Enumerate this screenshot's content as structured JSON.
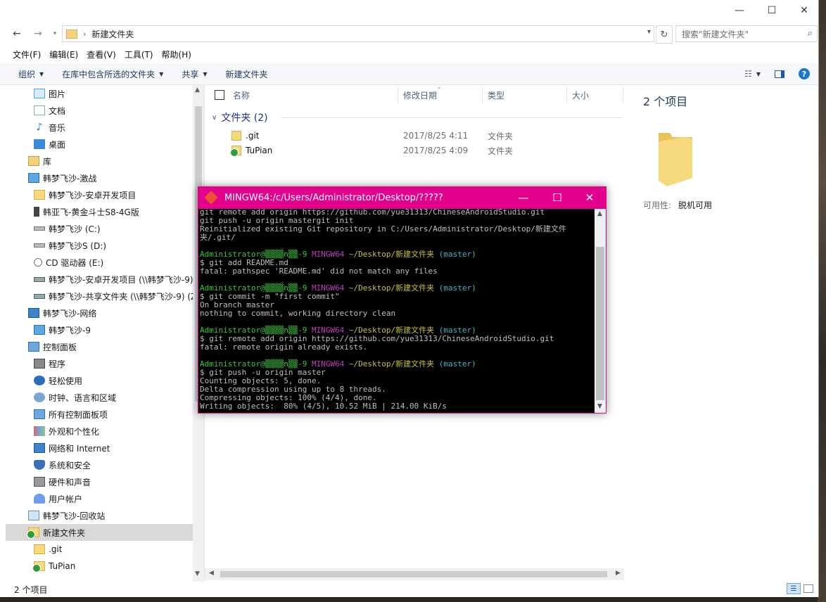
{
  "explorer": {
    "window_controls": {
      "minimize": "—",
      "maximize": "☐",
      "close": "✕"
    },
    "address": {
      "current": "新建文件夹"
    },
    "search": {
      "placeholder": "搜索\"新建文件夹\""
    },
    "menu": [
      "文件(F)",
      "编辑(E)",
      "查看(V)",
      "工具(T)",
      "帮助(H)"
    ],
    "toolbar": {
      "organize": "组织",
      "include_in_library": "在库中包含所选的文件夹",
      "share": "共享",
      "new_folder": "新建文件夹"
    },
    "nav": [
      {
        "label": "图片",
        "icon": "pictures-icon",
        "indent": 1
      },
      {
        "label": "文档",
        "icon": "documents-icon",
        "indent": 1
      },
      {
        "label": "音乐",
        "icon": "music-icon",
        "indent": 1
      },
      {
        "label": "桌面",
        "icon": "desktop-icon",
        "indent": 1
      },
      {
        "label": "库",
        "icon": "library-icon",
        "indent": 0
      },
      {
        "label": "韩梦飞沙-激战",
        "icon": "computer-icon",
        "indent": 0
      },
      {
        "label": "韩梦飞沙-安卓开发项目",
        "icon": "folder-icon",
        "indent": 1
      },
      {
        "label": "韩亚飞-黄金斗士S8-4G版",
        "icon": "phone-icon",
        "indent": 1
      },
      {
        "label": "韩梦飞沙 (C:)",
        "icon": "drive-icon",
        "indent": 1
      },
      {
        "label": "韩梦飞沙S (D:)",
        "icon": "drive-icon",
        "indent": 1
      },
      {
        "label": "CD 驱动器 (E:)",
        "icon": "cd-drive-icon",
        "indent": 1
      },
      {
        "label": "韩梦飞沙-安卓开发项目 (\\\\韩梦飞沙-9) (",
        "icon": "network-drive-icon",
        "indent": 1
      },
      {
        "label": "韩梦飞沙-共享文件夹 (\\\\韩梦飞沙-9) (Z",
        "icon": "network-drive-icon",
        "indent": 1
      },
      {
        "label": "韩梦飞沙-网络",
        "icon": "network-icon",
        "indent": 0
      },
      {
        "label": "韩梦飞沙-9",
        "icon": "computer-icon",
        "indent": 1
      },
      {
        "label": "控制面板",
        "icon": "control-panel-icon",
        "indent": 0
      },
      {
        "label": "程序",
        "icon": "programs-icon",
        "indent": 1
      },
      {
        "label": "轻松使用",
        "icon": "ease-of-access-icon",
        "indent": 1
      },
      {
        "label": "时钟、语言和区域",
        "icon": "clock-icon",
        "indent": 1
      },
      {
        "label": "所有控制面板项",
        "icon": "control-panel-icon",
        "indent": 1
      },
      {
        "label": "外观和个性化",
        "icon": "appearance-icon",
        "indent": 1
      },
      {
        "label": "网络和 Internet",
        "icon": "network-icon",
        "indent": 1
      },
      {
        "label": "系统和安全",
        "icon": "shield-icon",
        "indent": 1
      },
      {
        "label": "硬件和声音",
        "icon": "hardware-icon",
        "indent": 1
      },
      {
        "label": "用户帐户",
        "icon": "user-icon",
        "indent": 1
      },
      {
        "label": "韩梦飞沙-回收站",
        "icon": "recycle-bin-icon",
        "indent": 0
      },
      {
        "label": "新建文件夹",
        "icon": "folder-synced-icon",
        "indent": 0,
        "selected": true
      },
      {
        "label": ".git",
        "icon": "folder-icon",
        "indent": 1
      },
      {
        "label": "TuPian",
        "icon": "folder-synced-icon",
        "indent": 1
      }
    ],
    "columns": {
      "name": "名称",
      "modified": "修改日期",
      "type": "类型",
      "size": "大小"
    },
    "group": {
      "label": "文件夹 (2)"
    },
    "files": [
      {
        "name": ".git",
        "modified": "2017/8/25 4:11",
        "type": "文件夹",
        "icon": "folder-icon"
      },
      {
        "name": "TuPian",
        "modified": "2017/8/25 4:09",
        "type": "文件夹",
        "icon": "folder-synced-icon"
      }
    ],
    "details": {
      "title": "2 个项目",
      "availability_label": "可用性:",
      "availability_value": "脱机可用"
    },
    "status": {
      "count": "2 个项目"
    }
  },
  "terminal": {
    "title": "MINGW64:/c/Users/Administrator/Desktop/?????",
    "lines": [
      {
        "segments": [
          {
            "t": "git remote add origin https://github.com/yue31313/ChineseAndroidStudio.git",
            "c": ""
          }
        ]
      },
      {
        "segments": [
          {
            "t": "git push -u origin mastergit init",
            "c": ""
          }
        ]
      },
      {
        "segments": [
          {
            "t": "Reinitialized existing Git repository in C:/Users/Administrator/Desktop/新建文件",
            "c": ""
          }
        ]
      },
      {
        "segments": [
          {
            "t": "夹/.git/",
            "c": ""
          }
        ]
      },
      {
        "segments": [
          {
            "t": "",
            "c": ""
          }
        ]
      },
      {
        "segments": [
          {
            "t": "Administrator@▒▒▒▒n▒▒-9 ",
            "c": "c-green"
          },
          {
            "t": "MINGW64 ",
            "c": "c-mag"
          },
          {
            "t": "~/Desktop/新建文件夹 ",
            "c": "c-yel"
          },
          {
            "t": "(master)",
            "c": "c-cyan"
          }
        ]
      },
      {
        "segments": [
          {
            "t": "$ git add README.md",
            "c": ""
          }
        ]
      },
      {
        "segments": [
          {
            "t": "fatal: pathspec 'README.md' did not match any files",
            "c": ""
          }
        ]
      },
      {
        "segments": [
          {
            "t": "",
            "c": ""
          }
        ]
      },
      {
        "segments": [
          {
            "t": "Administrator@▒▒▒▒n▒▒-9 ",
            "c": "c-green"
          },
          {
            "t": "MINGW64 ",
            "c": "c-mag"
          },
          {
            "t": "~/Desktop/新建文件夹 ",
            "c": "c-yel"
          },
          {
            "t": "(master)",
            "c": "c-cyan"
          }
        ]
      },
      {
        "segments": [
          {
            "t": "$ git commit -m \"first commit\"",
            "c": ""
          }
        ]
      },
      {
        "segments": [
          {
            "t": "On branch master",
            "c": ""
          }
        ]
      },
      {
        "segments": [
          {
            "t": "nothing to commit, working directory clean",
            "c": ""
          }
        ]
      },
      {
        "segments": [
          {
            "t": "",
            "c": ""
          }
        ]
      },
      {
        "segments": [
          {
            "t": "Administrator@▒▒▒▒n▒▒-9 ",
            "c": "c-green"
          },
          {
            "t": "MINGW64 ",
            "c": "c-mag"
          },
          {
            "t": "~/Desktop/新建文件夹 ",
            "c": "c-yel"
          },
          {
            "t": "(master)",
            "c": "c-cyan"
          }
        ]
      },
      {
        "segments": [
          {
            "t": "$ git remote add origin https://github.com/yue31313/ChineseAndroidStudio.git",
            "c": ""
          }
        ]
      },
      {
        "segments": [
          {
            "t": "fatal: remote origin already exists.",
            "c": ""
          }
        ]
      },
      {
        "segments": [
          {
            "t": "",
            "c": ""
          }
        ]
      },
      {
        "segments": [
          {
            "t": "Administrator@▒▒▒▒n▒▒-9 ",
            "c": "c-green"
          },
          {
            "t": "MINGW64 ",
            "c": "c-mag"
          },
          {
            "t": "~/Desktop/新建文件夹 ",
            "c": "c-yel"
          },
          {
            "t": "(master)",
            "c": "c-cyan"
          }
        ]
      },
      {
        "segments": [
          {
            "t": "$ git push -u origin master",
            "c": ""
          }
        ]
      },
      {
        "segments": [
          {
            "t": "Counting objects: 5, done.",
            "c": ""
          }
        ]
      },
      {
        "segments": [
          {
            "t": "Delta compression using up to 8 threads.",
            "c": ""
          }
        ]
      },
      {
        "segments": [
          {
            "t": "Compressing objects: 100% (4/4), done.",
            "c": ""
          }
        ]
      },
      {
        "segments": [
          {
            "t": "Writing objects:  80% (4/5), 10.52 MiB | 214.00 KiB/s",
            "c": ""
          }
        ]
      }
    ]
  },
  "colors": {
    "terminal_frame": "#e3008c",
    "toolbar_text": "#1e395b",
    "group_header": "#1e3287"
  }
}
